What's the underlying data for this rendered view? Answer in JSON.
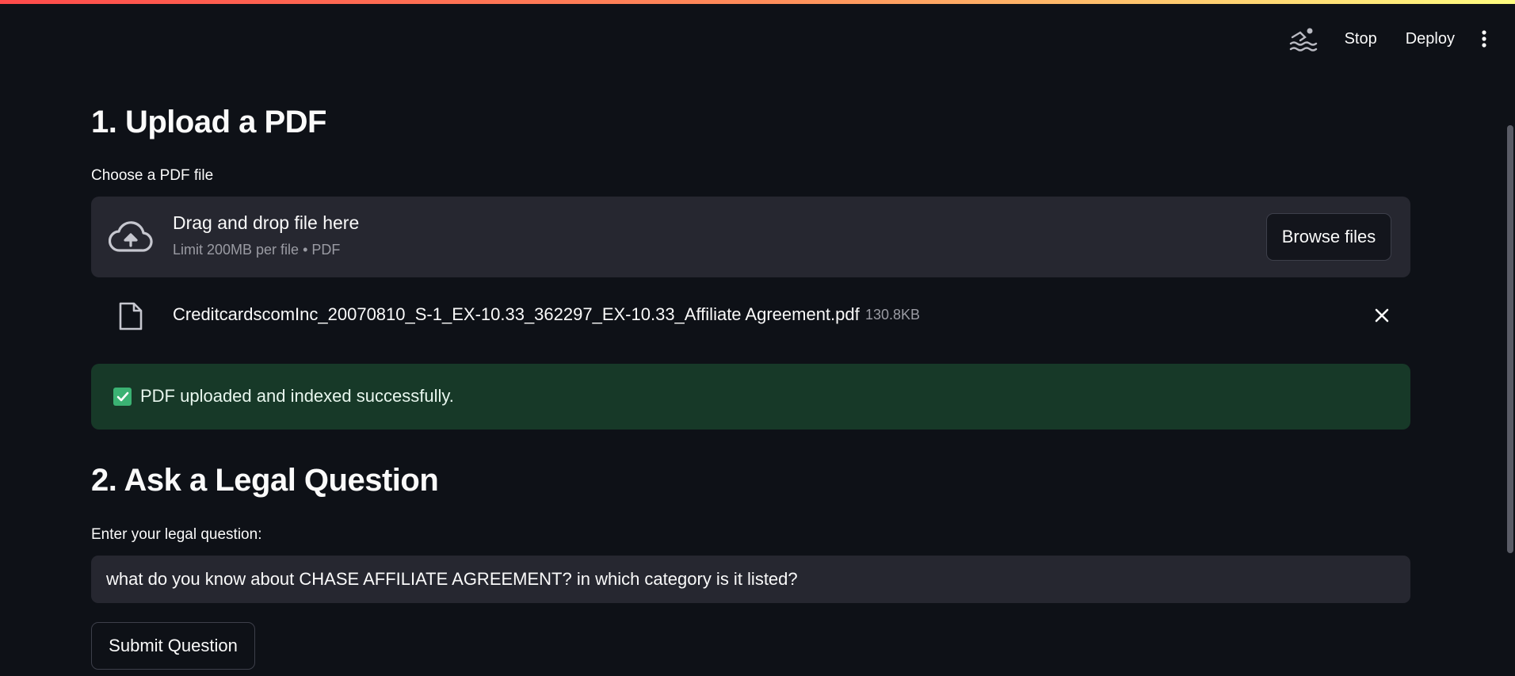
{
  "header": {
    "running_icon": "swimmer-icon",
    "stop_label": "Stop",
    "deploy_label": "Deploy",
    "menu_icon": "kebab-menu-icon"
  },
  "upload": {
    "title": "1. Upload a PDF",
    "field_label": "Choose a PDF file",
    "dropzone_title": "Drag and drop file here",
    "dropzone_limit": "Limit 200MB per file • PDF",
    "browse_label": "Browse files",
    "file_name": "CreditcardscomInc_20070810_S-1_EX-10.33_362297_EX-10.33_Affiliate Agreement.pdf",
    "file_size": "130.8KB",
    "success_message": "PDF uploaded and indexed successfully."
  },
  "question": {
    "title": "2. Ask a Legal Question",
    "field_label": "Enter your legal question:",
    "value": "what do you know about CHASE AFFILIATE AGREEMENT? in which category is it listed?",
    "submit_label": "Submit Question"
  },
  "colors": {
    "background": "#0e1117",
    "surface": "#262730",
    "success_bg": "#173928",
    "success_accent": "#3bb273"
  }
}
